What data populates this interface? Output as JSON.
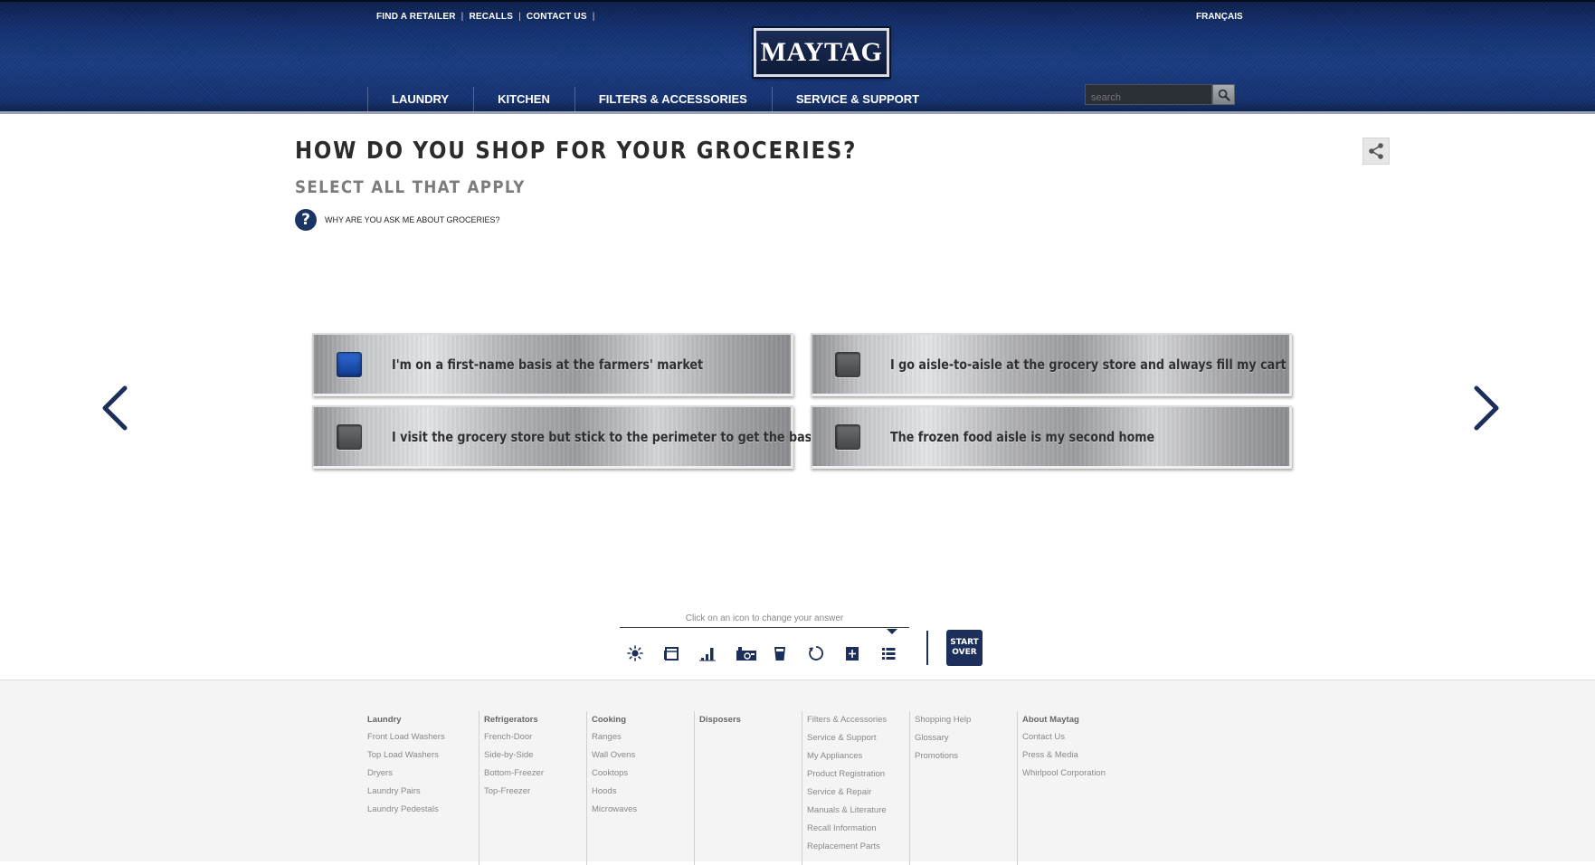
{
  "header": {
    "util_links": [
      "FIND A RETAILER",
      "RECALLS",
      "CONTACT US"
    ],
    "language": "FRANÇAIS",
    "logo": "MAYTAG",
    "nav": [
      "LAUNDRY",
      "KITCHEN",
      "FILTERS & ACCESSORIES",
      "SERVICE & SUPPORT"
    ],
    "search_placeholder": "search",
    "search_icon": "search-icon"
  },
  "question": {
    "title": "HOW DO YOU SHOP FOR YOUR GROCERIES?",
    "subtitle": "SELECT ALL THAT APPLY",
    "why_link": "WHY ARE YOU ASK ME ABOUT GROCERIES?",
    "options": [
      {
        "label": "I'm on a first-name basis at the farmers' market",
        "selected": true
      },
      {
        "label": "I go aisle-to-aisle at the grocery store and always fill my cart",
        "selected": false
      },
      {
        "label": "I visit the grocery store but stick to the perimeter to get the basics",
        "selected": false
      },
      {
        "label": "The frozen food aisle is my second home",
        "selected": false
      }
    ]
  },
  "progress": {
    "caption": "Click on an icon to change your answer",
    "icons": [
      "sun-icon",
      "fridge-icon",
      "bar-chart-icon",
      "kitchen-icon",
      "cup-icon",
      "cycle-icon",
      "freezer-icon",
      "list-icon"
    ],
    "start_over_line1": "START",
    "start_over_line2": "OVER"
  },
  "footer": {
    "columns": [
      {
        "heading": "Laundry",
        "links": [
          "Front Load Washers",
          "Top Load Washers",
          "Dryers",
          "Laundry Pairs",
          "Laundry Pedestals"
        ]
      },
      {
        "heading": "Refrigerators",
        "links": [
          "French-Door",
          "Side-by-Side",
          "Bottom-Freezer",
          "Top-Freezer"
        ]
      },
      {
        "heading": "Cooking",
        "links": [
          "Ranges",
          "Wall Ovens",
          "Cooktops",
          "Hoods",
          "Microwaves"
        ]
      },
      {
        "heading": "Disposers",
        "links": []
      },
      {
        "heading": "Filters & Accessories",
        "links": [
          "Service & Support",
          "My Appliances",
          "Product Registration",
          "Service & Repair",
          "Manuals & Literature",
          "Recall Information",
          "Replacement Parts"
        ]
      },
      {
        "heading": "Shopping Help",
        "links": [
          "Glossary",
          "Promotions"
        ]
      },
      {
        "heading": "About Maytag",
        "links": [
          "Contact Us",
          "Press & Media",
          "Whirlpool Corporation"
        ]
      }
    ]
  },
  "colors": {
    "brand_navy": "#1b2f5a",
    "header_blue": "#1a3c82",
    "selected_blue": "#2f6ad8"
  }
}
